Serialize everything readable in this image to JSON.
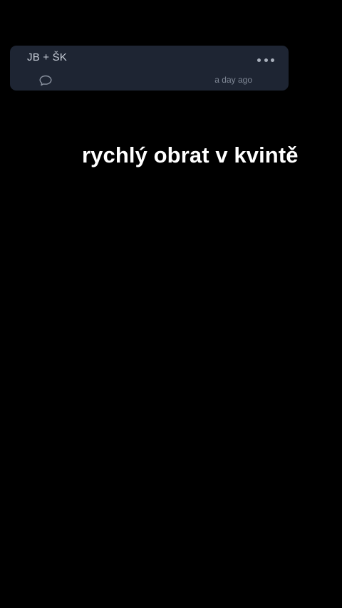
{
  "card": {
    "title": "JB + ŠK",
    "timestamp": "a day ago",
    "more_icon": "ellipsis-icon",
    "comment_icon": "comment-bubble-icon"
  },
  "caption": {
    "text": "rychlý obrat v kvintě"
  },
  "colors": {
    "background": "#000000",
    "card_background": "#1e2533",
    "title_text": "#c9cfd9",
    "muted_text": "#7f8795",
    "caption_text": "#ffffff"
  }
}
